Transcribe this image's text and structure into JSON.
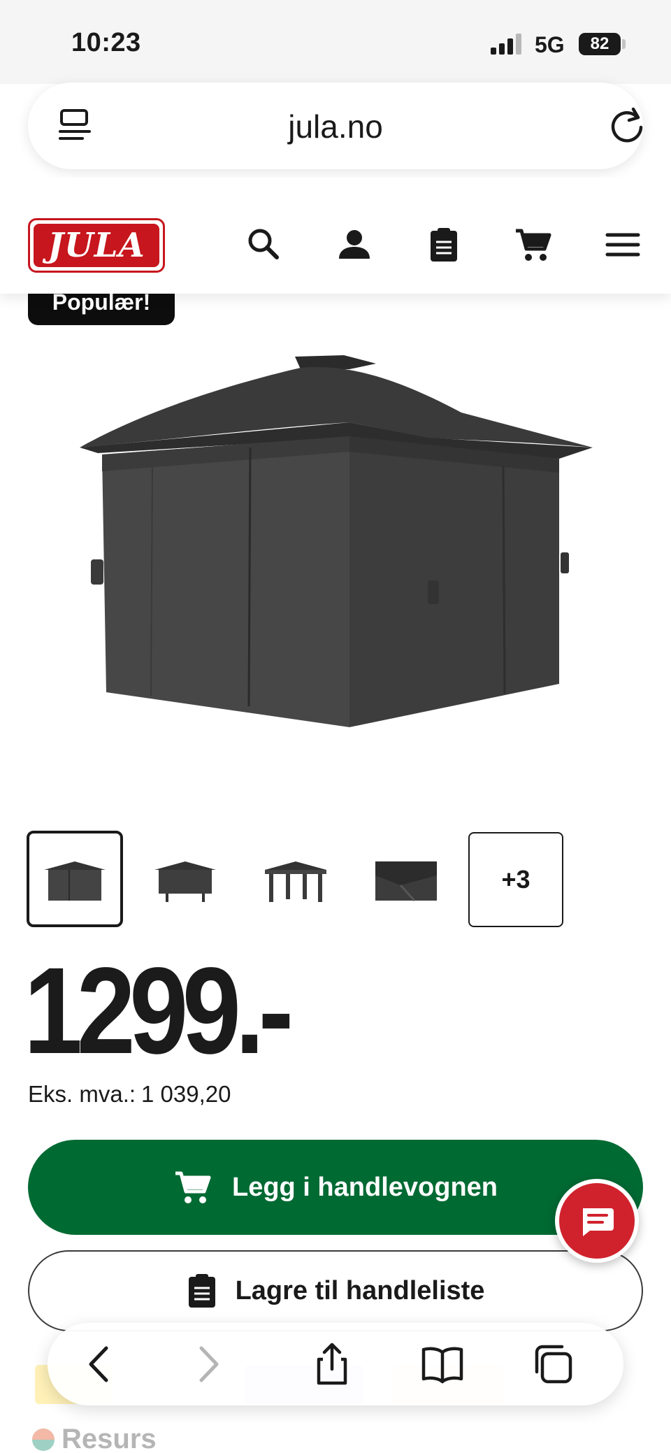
{
  "status_bar": {
    "time": "10:23",
    "network": "5G",
    "battery": "82"
  },
  "browser": {
    "url": "jula.no"
  },
  "header": {
    "logo_text": "JULA",
    "icons": [
      "search-icon",
      "account-icon",
      "shopping-list-icon",
      "cart-icon",
      "menu-icon"
    ]
  },
  "product": {
    "badge": "Populær!",
    "thumbnails_more": "+3",
    "price": "1299.-",
    "ex_vat_label": "Eks. mva.:",
    "ex_vat_value": "1 039,20"
  },
  "actions": {
    "add_to_cart": "Legg i handlevognen",
    "save_to_list": "Lagre til handleliste"
  },
  "footer": {
    "resurs_label": "Resurs"
  },
  "colors": {
    "primary_green": "#006a33",
    "brand_red": "#c7161d",
    "chat_red": "#d0222d"
  }
}
